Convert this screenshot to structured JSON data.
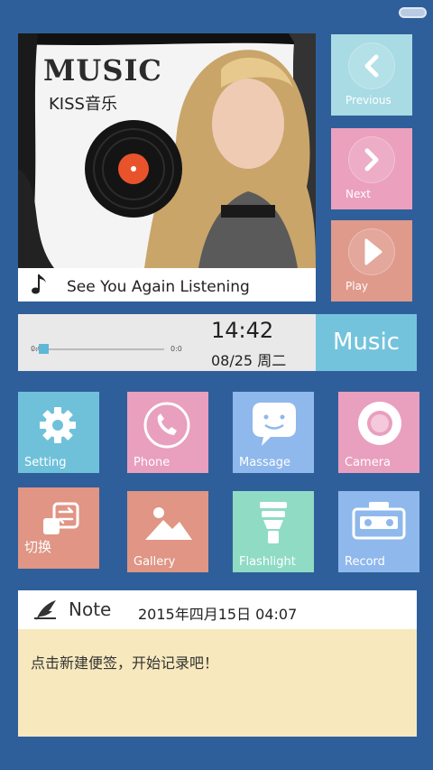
{
  "album": {
    "logo": "MUSIC",
    "subtitle": "KISS音乐",
    "now_playing": "See You Again   Listening"
  },
  "controls": [
    {
      "label": "Previous",
      "icon": "chevron-left-icon",
      "color": "#a8dbe3"
    },
    {
      "label": "Next",
      "icon": "chevron-right-icon",
      "color": "#eba0bd"
    },
    {
      "label": "Play",
      "icon": "play-icon",
      "color": "#df9a8b"
    }
  ],
  "player": {
    "elapsed": "0:0",
    "total": "0:0",
    "progress": 0.05,
    "time": "14:42",
    "date": "08/25 周二",
    "music_label": "Music"
  },
  "apps": [
    {
      "label": "Setting",
      "icon": "gear-icon",
      "color": "#6fc1da"
    },
    {
      "label": "Phone",
      "icon": "phone-icon",
      "color": "#e99fbe"
    },
    {
      "label": "Massage",
      "icon": "chat-bubble-icon",
      "color": "#8fb8ec"
    },
    {
      "label": "Camera",
      "icon": "camera-lens-icon",
      "color": "#e99fbe"
    },
    {
      "label": "切换",
      "icon": "switch-icon",
      "color": "#e09585"
    },
    {
      "label": "Gallery",
      "icon": "gallery-icon",
      "color": "#e09585"
    },
    {
      "label": "Flashlight",
      "icon": "flashlight-icon",
      "color": "#8fdbc4"
    },
    {
      "label": "Record",
      "icon": "cassette-icon",
      "color": "#8fb8ec"
    }
  ],
  "note": {
    "title": "Note",
    "datetime": "2015年四月15日 04:07",
    "placeholder": "点击新建便签，开始记录吧！"
  },
  "colors": {
    "background": "#2f5f9a",
    "note_body": "#f7e8bd",
    "accent": "#74c3dc"
  }
}
